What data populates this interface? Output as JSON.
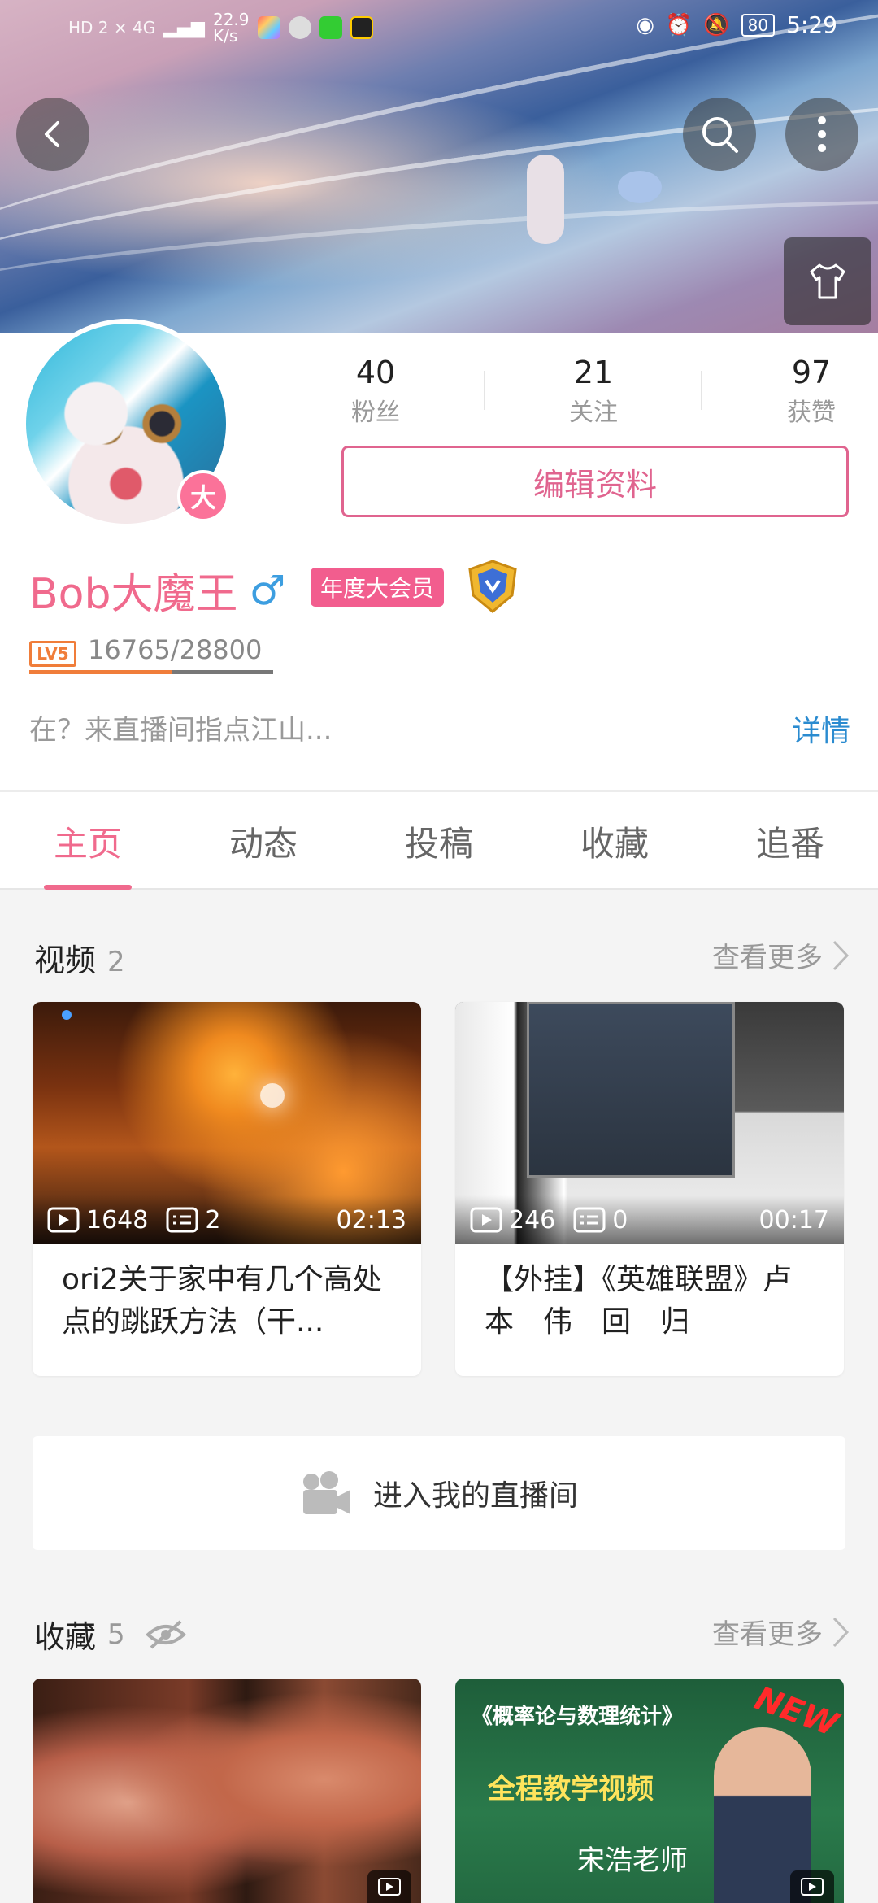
{
  "status_bar": {
    "left_indicators": "HD 2  ×  4G",
    "speed": "22.9",
    "speed_unit": "K/s",
    "battery": "80",
    "time": "5:29"
  },
  "profile": {
    "stats": [
      {
        "value": "40",
        "label": "粉丝"
      },
      {
        "value": "21",
        "label": "关注"
      },
      {
        "value": "97",
        "label": "获赞"
      }
    ],
    "edit_label": "编辑资料",
    "avatar_badge": "大",
    "username": "Bob大魔王",
    "gender_symbol": "♂",
    "vip_label": "年度大会员",
    "level_label": "LV5",
    "exp_text": "16765/28800",
    "exp_fraction": 0.582,
    "signature": "在？来直播间指点江山...",
    "detail_label": "详情"
  },
  "tabs": [
    {
      "label": "主页",
      "active": true
    },
    {
      "label": "动态",
      "active": false
    },
    {
      "label": "投稿",
      "active": false
    },
    {
      "label": "收藏",
      "active": false
    },
    {
      "label": "追番",
      "active": false
    }
  ],
  "videos_section": {
    "title": "视频",
    "count": "2",
    "more_label": "查看更多",
    "items": [
      {
        "views": "1648",
        "danmaku": "2",
        "duration": "02:13",
        "title": "ori2关于家中有几个高处点的跳跃方法（干..."
      },
      {
        "views": "246",
        "danmaku": "0",
        "duration": "00:17",
        "title": "【外挂】《英雄联盟》卢　本　伟　回　归"
      }
    ]
  },
  "live_entry": {
    "label": "进入我的直播间"
  },
  "favorites_section": {
    "title": "收藏",
    "count": "5",
    "more_label": "查看更多",
    "items": [
      {
        "thumb_text": []
      },
      {
        "thumb_text": [
          "《概率论与数理统计》",
          "全程教学视频",
          "宋浩老师",
          "NEW"
        ]
      }
    ]
  },
  "colors": {
    "accent_pink": "#f06a8d",
    "link_blue": "#2a8bd0",
    "level_orange": "#f07d3a"
  },
  "icons": [
    "back-arrow-icon",
    "search-icon",
    "more-vertical-icon",
    "tshirt-icon",
    "play-icon",
    "danmaku-icon",
    "chevron-right-icon",
    "camera-icon",
    "eye-slash-icon",
    "medal-icon"
  ]
}
